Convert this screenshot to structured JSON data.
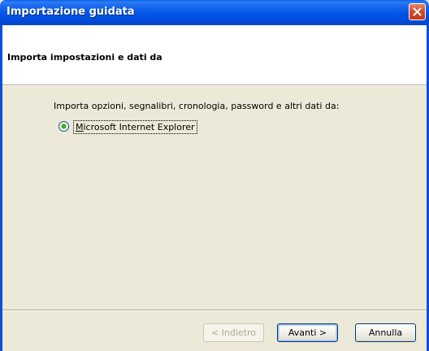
{
  "window": {
    "title": "Importazione guidata"
  },
  "header": {
    "title": "Importa impostazioni e dati da"
  },
  "main": {
    "prompt": "Importa opzioni, segnalibri, cronologia, password e altri dati da:",
    "options": [
      {
        "label_first": "M",
        "label_rest": "icrosoft Internet Explorer",
        "selected": true
      }
    ]
  },
  "footer": {
    "back_label": "< Indietro",
    "next_label": "Avanti >",
    "cancel_label": "Annulla"
  },
  "colors": {
    "titlebar": "#0055E5",
    "dialog_bg": "#ECE9D8",
    "radio_dot": "#3DB135",
    "close_button": "#D44E2B"
  }
}
